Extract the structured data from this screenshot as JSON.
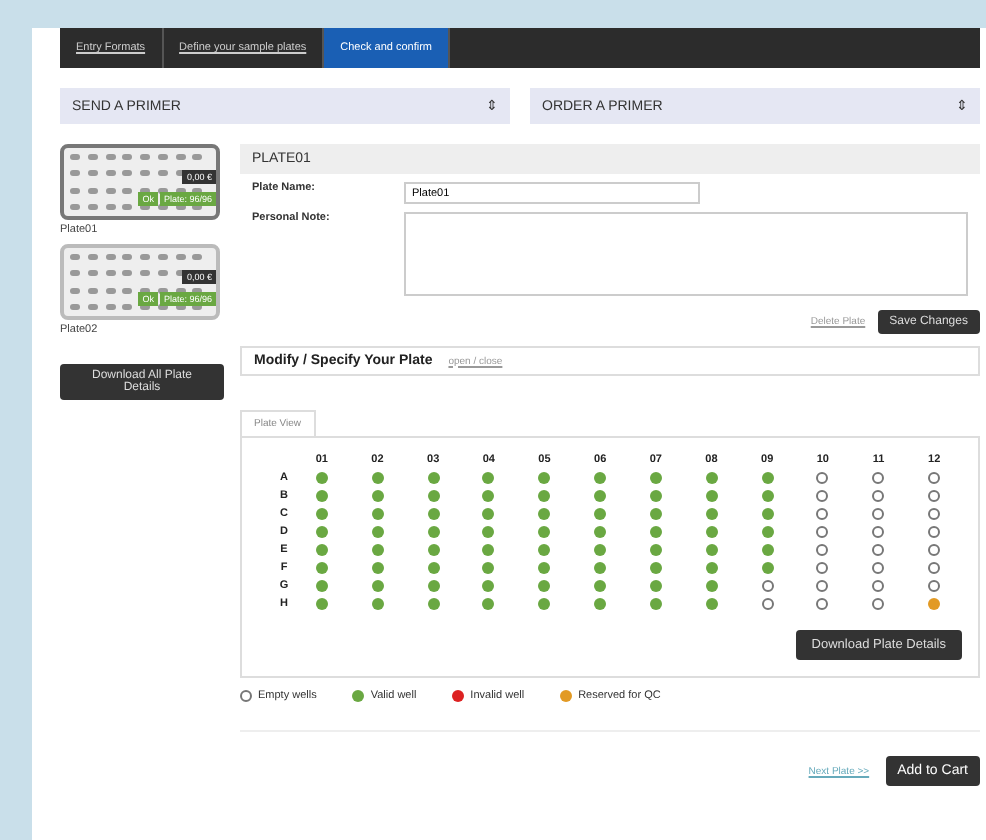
{
  "tabs": [
    {
      "label": "Entry Formats",
      "selected": false
    },
    {
      "label": "Define your sample plates",
      "selected": false
    },
    {
      "label": "Check and confirm",
      "selected": true
    }
  ],
  "selects": [
    {
      "value": "SEND A PRIMER",
      "arrow": "⇕"
    },
    {
      "value": "ORDER A PRIMER",
      "arrow": "⇕"
    }
  ],
  "plates": [
    {
      "label": "Plate01",
      "price": "0,00 €",
      "status": "Ok",
      "count": "Plate: 96/96",
      "selected": true
    },
    {
      "label": "Plate02",
      "price": "0,00 €",
      "status": "Ok",
      "count": "Plate: 96/96",
      "selected": false
    }
  ],
  "download_all_button": "Download All Plate Details",
  "plate_header": "PLATE01",
  "form": {
    "name_label": "Plate Name:",
    "name_value": "Plate01",
    "note_label": "Personal Note:"
  },
  "delete_button": "Delete Plate",
  "save_button": "Save Changes",
  "modify": {
    "title": "Modify / Specify Your Plate",
    "link": "open / close"
  },
  "plate_view_tab": "Plate View",
  "columns": [
    "01",
    "02",
    "03",
    "04",
    "05",
    "06",
    "07",
    "08",
    "09",
    "10",
    "11",
    "12"
  ],
  "rows": [
    {
      "label": "A",
      "wells": [
        {
          "kind": "valid"
        },
        {
          "kind": "valid"
        },
        {
          "kind": "valid"
        },
        {
          "kind": "valid"
        },
        {
          "kind": "valid"
        },
        {
          "kind": "valid"
        },
        {
          "kind": "valid"
        },
        {
          "kind": "valid"
        },
        {
          "kind": "valid"
        },
        {
          "kind": "empty"
        },
        {
          "kind": "empty"
        },
        {
          "kind": "empty"
        }
      ]
    },
    {
      "label": "B",
      "wells": [
        {
          "kind": "valid"
        },
        {
          "kind": "valid"
        },
        {
          "kind": "valid"
        },
        {
          "kind": "valid"
        },
        {
          "kind": "valid"
        },
        {
          "kind": "valid"
        },
        {
          "kind": "valid"
        },
        {
          "kind": "valid"
        },
        {
          "kind": "valid"
        },
        {
          "kind": "empty"
        },
        {
          "kind": "empty"
        },
        {
          "kind": "empty"
        }
      ]
    },
    {
      "label": "C",
      "wells": [
        {
          "kind": "valid"
        },
        {
          "kind": "valid"
        },
        {
          "kind": "valid"
        },
        {
          "kind": "valid"
        },
        {
          "kind": "valid"
        },
        {
          "kind": "valid"
        },
        {
          "kind": "valid"
        },
        {
          "kind": "valid"
        },
        {
          "kind": "valid"
        },
        {
          "kind": "empty"
        },
        {
          "kind": "empty"
        },
        {
          "kind": "empty"
        }
      ]
    },
    {
      "label": "D",
      "wells": [
        {
          "kind": "valid"
        },
        {
          "kind": "valid"
        },
        {
          "kind": "valid"
        },
        {
          "kind": "valid"
        },
        {
          "kind": "valid"
        },
        {
          "kind": "valid"
        },
        {
          "kind": "valid"
        },
        {
          "kind": "valid"
        },
        {
          "kind": "valid"
        },
        {
          "kind": "empty"
        },
        {
          "kind": "empty"
        },
        {
          "kind": "empty"
        }
      ]
    },
    {
      "label": "E",
      "wells": [
        {
          "kind": "valid"
        },
        {
          "kind": "valid"
        },
        {
          "kind": "valid"
        },
        {
          "kind": "valid"
        },
        {
          "kind": "valid"
        },
        {
          "kind": "valid"
        },
        {
          "kind": "valid"
        },
        {
          "kind": "valid"
        },
        {
          "kind": "valid"
        },
        {
          "kind": "empty"
        },
        {
          "kind": "empty"
        },
        {
          "kind": "empty"
        }
      ]
    },
    {
      "label": "F",
      "wells": [
        {
          "kind": "valid"
        },
        {
          "kind": "valid"
        },
        {
          "kind": "valid"
        },
        {
          "kind": "valid"
        },
        {
          "kind": "valid"
        },
        {
          "kind": "valid"
        },
        {
          "kind": "valid"
        },
        {
          "kind": "valid"
        },
        {
          "kind": "valid"
        },
        {
          "kind": "empty"
        },
        {
          "kind": "empty"
        },
        {
          "kind": "empty"
        }
      ]
    },
    {
      "label": "G",
      "wells": [
        {
          "kind": "valid"
        },
        {
          "kind": "valid"
        },
        {
          "kind": "valid"
        },
        {
          "kind": "valid"
        },
        {
          "kind": "valid"
        },
        {
          "kind": "valid"
        },
        {
          "kind": "valid"
        },
        {
          "kind": "valid"
        },
        {
          "kind": "empty"
        },
        {
          "kind": "empty"
        },
        {
          "kind": "empty"
        },
        {
          "kind": "empty"
        }
      ]
    },
    {
      "label": "H",
      "wells": [
        {
          "kind": "valid"
        },
        {
          "kind": "valid"
        },
        {
          "kind": "valid"
        },
        {
          "kind": "valid"
        },
        {
          "kind": "valid"
        },
        {
          "kind": "valid"
        },
        {
          "kind": "valid"
        },
        {
          "kind": "valid"
        },
        {
          "kind": "empty"
        },
        {
          "kind": "empty"
        },
        {
          "kind": "empty"
        },
        {
          "kind": "reserved"
        }
      ]
    }
  ],
  "download_button": "Download Plate Details",
  "legend": [
    {
      "kind": "empty",
      "label": "Empty wells"
    },
    {
      "kind": "valid",
      "label": "Valid well"
    },
    {
      "kind": "invalid",
      "label": "Invalid well"
    },
    {
      "kind": "reserved",
      "label": "Reserved for QC"
    }
  ],
  "next_link": "Next Plate >>",
  "cart_button": "Add to Cart"
}
